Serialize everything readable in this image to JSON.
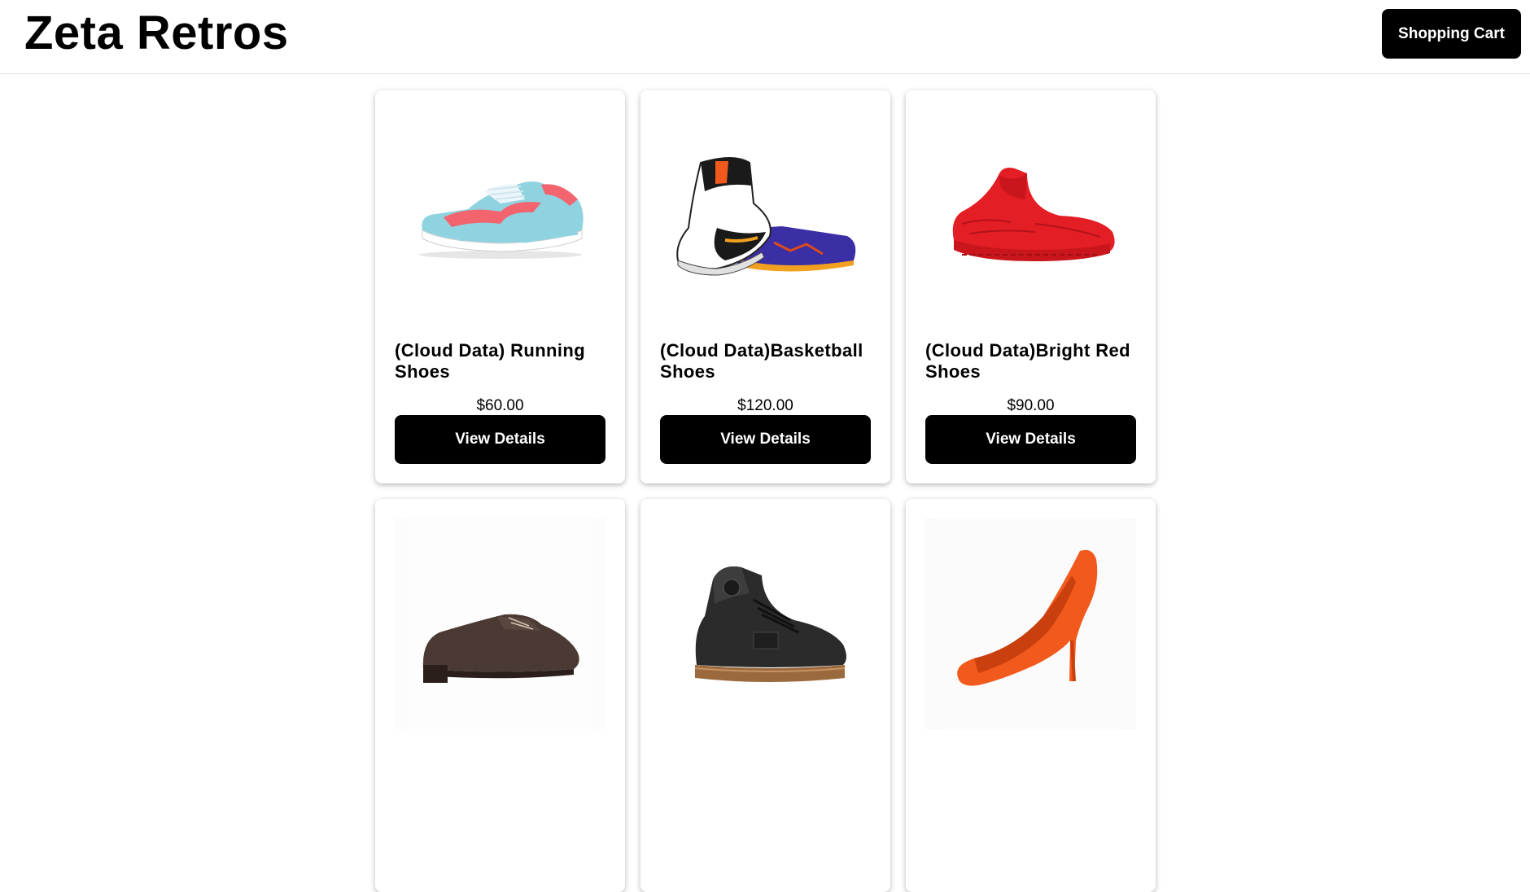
{
  "header": {
    "brand": "Zeta Retros",
    "cart_label": "Shopping Cart"
  },
  "products": [
    {
      "name": "(Cloud Data) Running Shoes",
      "price": "$60.00",
      "button_label": "View Details",
      "image": "light-blue-pink-running-shoe",
      "colors": {
        "primary": "#8fd3e0",
        "accent": "#f2646e"
      }
    },
    {
      "name": "(Cloud Data)Basketball Shoes",
      "price": "$120.00",
      "button_label": "View Details",
      "image": "white-black-purple-basketball-shoes",
      "colors": {
        "primary": "#ffffff",
        "accent": "#3b2fa5"
      }
    },
    {
      "name": "(Cloud Data)Bright Red Shoes",
      "price": "$90.00",
      "button_label": "View Details",
      "image": "bright-red-high-top-shoe",
      "colors": {
        "primary": "#e31e24",
        "accent": "#b3121a"
      }
    },
    {
      "name": "",
      "price": "",
      "button_label": "",
      "image": "brown-leather-oxford-shoe",
      "colors": {
        "primary": "#4a3a33",
        "accent": "#2a1f1a"
      }
    },
    {
      "name": "",
      "price": "",
      "button_label": "",
      "image": "black-skate-high-top-shoe",
      "colors": {
        "primary": "#2b2b2b",
        "accent": "#9a6a3e"
      }
    },
    {
      "name": "",
      "price": "",
      "button_label": "",
      "image": "orange-stiletto-heel",
      "colors": {
        "primary": "#f25a1d",
        "accent": "#c9400e"
      }
    }
  ]
}
